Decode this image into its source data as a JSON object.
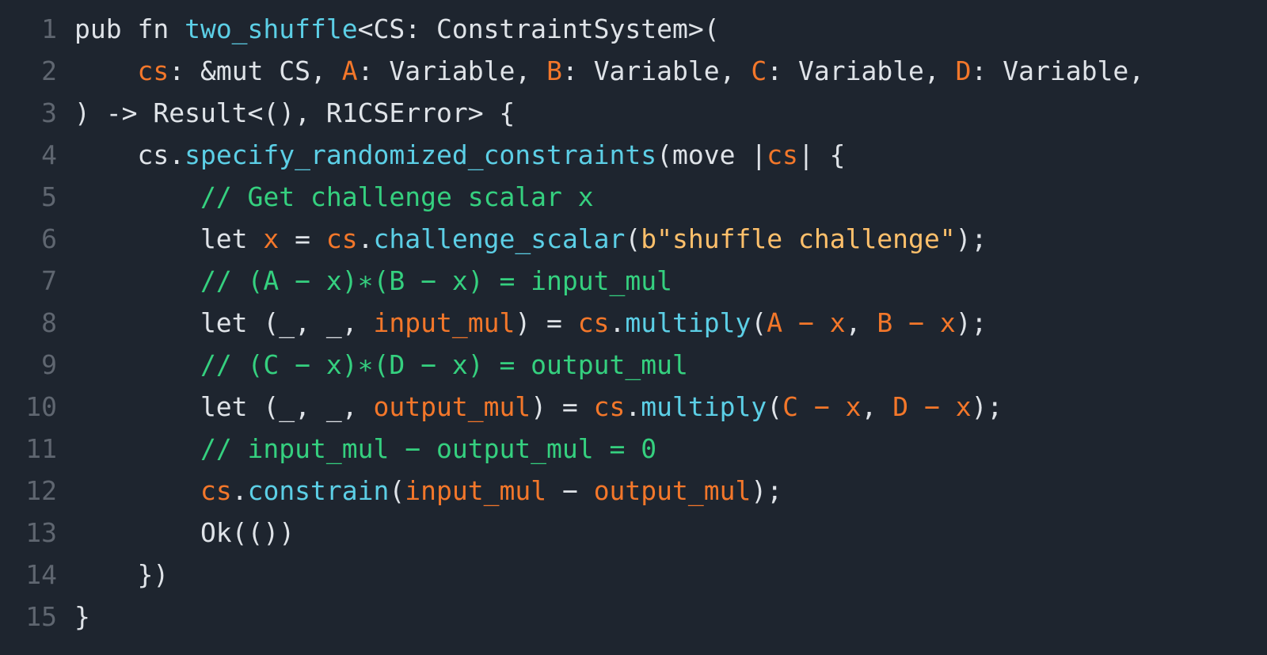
{
  "colors": {
    "background": "#1e252f",
    "line_number": "#5f6670",
    "plain": "#dfe3e8",
    "function": "#5ccfe6",
    "variable": "#f3772a",
    "comment": "#35d07f",
    "string": "#ffc06b"
  },
  "lines": [
    {
      "num": "1",
      "tokens": [
        {
          "t": "pub fn ",
          "k": "plain"
        },
        {
          "t": "two_shuffle",
          "k": "fn"
        },
        {
          "t": "<CS: ConstraintSystem>(",
          "k": "plain"
        }
      ]
    },
    {
      "num": "2",
      "tokens": [
        {
          "t": "    ",
          "k": "plain"
        },
        {
          "t": "cs",
          "k": "var"
        },
        {
          "t": ": &mut CS, ",
          "k": "plain"
        },
        {
          "t": "A",
          "k": "var"
        },
        {
          "t": ": Variable, ",
          "k": "plain"
        },
        {
          "t": "B",
          "k": "var"
        },
        {
          "t": ": Variable, ",
          "k": "plain"
        },
        {
          "t": "C",
          "k": "var"
        },
        {
          "t": ": Variable, ",
          "k": "plain"
        },
        {
          "t": "D",
          "k": "var"
        },
        {
          "t": ": Variable,",
          "k": "plain"
        }
      ]
    },
    {
      "num": "3",
      "tokens": [
        {
          "t": ") -> Result<(), R1CSError> {",
          "k": "plain"
        }
      ]
    },
    {
      "num": "4",
      "tokens": [
        {
          "t": "    cs.",
          "k": "plain"
        },
        {
          "t": "specify_randomized_constraints",
          "k": "fn"
        },
        {
          "t": "(move |",
          "k": "plain"
        },
        {
          "t": "cs",
          "k": "var"
        },
        {
          "t": "| {",
          "k": "plain"
        }
      ]
    },
    {
      "num": "5",
      "tokens": [
        {
          "t": "        ",
          "k": "plain"
        },
        {
          "t": "// Get challenge scalar x",
          "k": "comment"
        }
      ]
    },
    {
      "num": "6",
      "tokens": [
        {
          "t": "        let ",
          "k": "plain"
        },
        {
          "t": "x",
          "k": "var"
        },
        {
          "t": " = ",
          "k": "plain"
        },
        {
          "t": "cs",
          "k": "var"
        },
        {
          "t": ".",
          "k": "plain"
        },
        {
          "t": "challenge_scalar",
          "k": "fn"
        },
        {
          "t": "(",
          "k": "plain"
        },
        {
          "t": "b\"shuffle challenge\"",
          "k": "string"
        },
        {
          "t": ");",
          "k": "plain"
        }
      ]
    },
    {
      "num": "7",
      "tokens": [
        {
          "t": "        ",
          "k": "plain"
        },
        {
          "t": "// (A − x)∗(B − x) = input_mul",
          "k": "comment"
        }
      ]
    },
    {
      "num": "8",
      "tokens": [
        {
          "t": "        let (_, _, ",
          "k": "plain"
        },
        {
          "t": "input_mul",
          "k": "var"
        },
        {
          "t": ") = ",
          "k": "plain"
        },
        {
          "t": "cs",
          "k": "var"
        },
        {
          "t": ".",
          "k": "plain"
        },
        {
          "t": "multiply",
          "k": "fn"
        },
        {
          "t": "(",
          "k": "plain"
        },
        {
          "t": "A − x",
          "k": "var"
        },
        {
          "t": ", ",
          "k": "plain"
        },
        {
          "t": "B − x",
          "k": "var"
        },
        {
          "t": ");",
          "k": "plain"
        }
      ]
    },
    {
      "num": "9",
      "tokens": [
        {
          "t": "        ",
          "k": "plain"
        },
        {
          "t": "// (C − x)∗(D − x) = output_mul",
          "k": "comment"
        }
      ]
    },
    {
      "num": "10",
      "tokens": [
        {
          "t": "        let (_, _, ",
          "k": "plain"
        },
        {
          "t": "output_mul",
          "k": "var"
        },
        {
          "t": ") = ",
          "k": "plain"
        },
        {
          "t": "cs",
          "k": "var"
        },
        {
          "t": ".",
          "k": "plain"
        },
        {
          "t": "multiply",
          "k": "fn"
        },
        {
          "t": "(",
          "k": "plain"
        },
        {
          "t": "C − x",
          "k": "var"
        },
        {
          "t": ", ",
          "k": "plain"
        },
        {
          "t": "D − x",
          "k": "var"
        },
        {
          "t": ");",
          "k": "plain"
        }
      ]
    },
    {
      "num": "11",
      "tokens": [
        {
          "t": "        ",
          "k": "plain"
        },
        {
          "t": "// input_mul − output_mul = 0",
          "k": "comment"
        }
      ]
    },
    {
      "num": "12",
      "tokens": [
        {
          "t": "        ",
          "k": "plain"
        },
        {
          "t": "cs",
          "k": "var"
        },
        {
          "t": ".",
          "k": "plain"
        },
        {
          "t": "constrain",
          "k": "fn"
        },
        {
          "t": "(",
          "k": "plain"
        },
        {
          "t": "input_mul",
          "k": "var"
        },
        {
          "t": " − ",
          "k": "plain"
        },
        {
          "t": "output_mul",
          "k": "var"
        },
        {
          "t": ");",
          "k": "plain"
        }
      ]
    },
    {
      "num": "13",
      "tokens": [
        {
          "t": "        Ok(())",
          "k": "plain"
        }
      ]
    },
    {
      "num": "14",
      "tokens": [
        {
          "t": "    })",
          "k": "plain"
        }
      ]
    },
    {
      "num": "15",
      "tokens": [
        {
          "t": "}",
          "k": "plain"
        }
      ]
    }
  ]
}
